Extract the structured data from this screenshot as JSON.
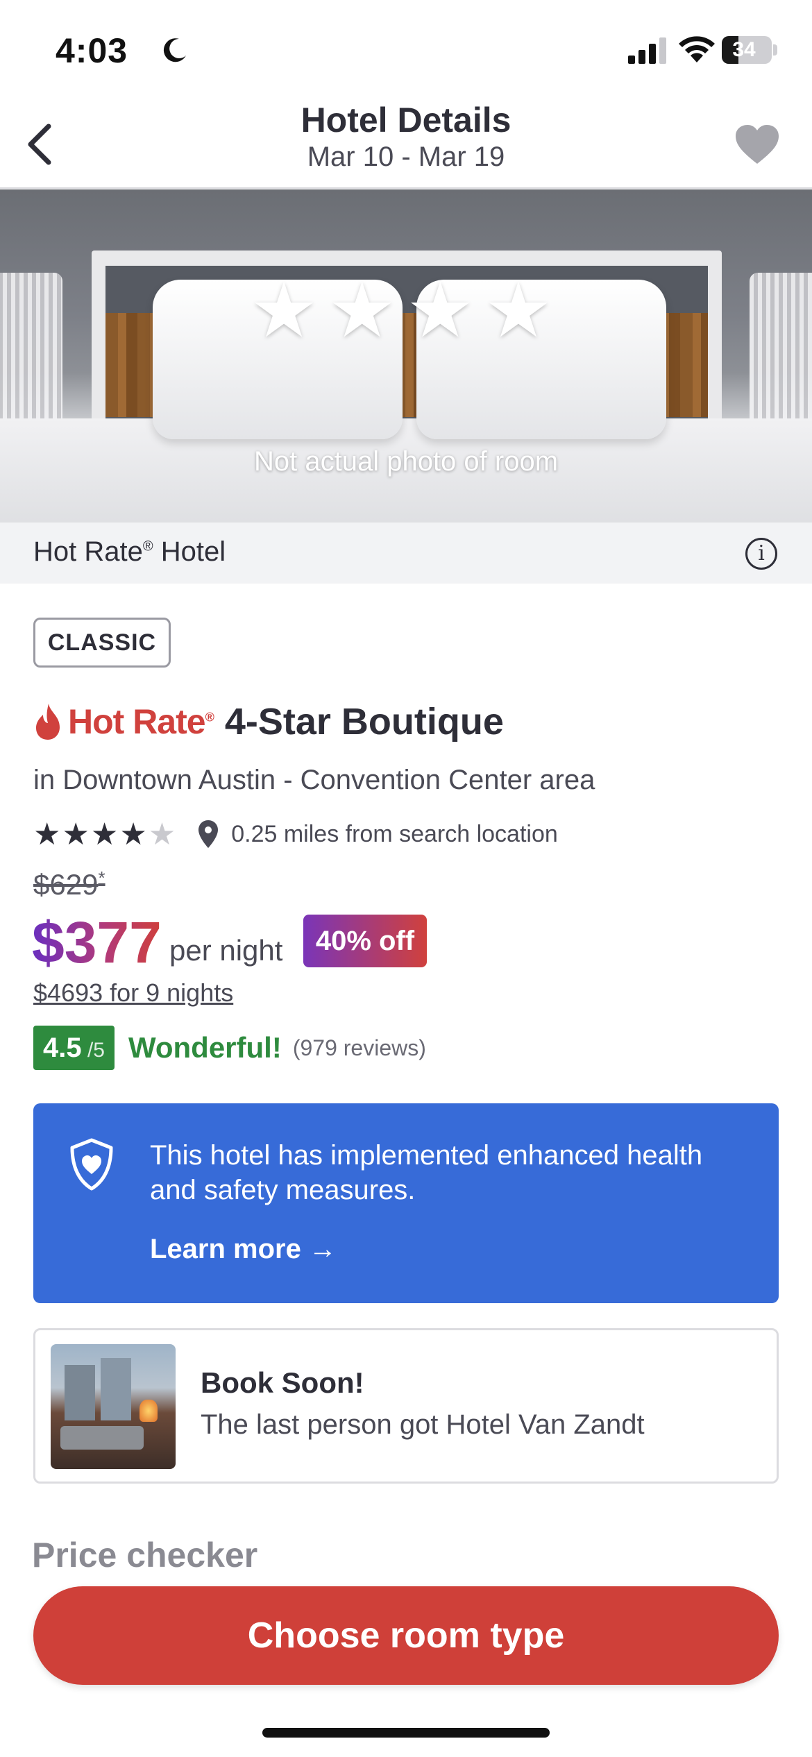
{
  "status_bar": {
    "time": "4:03",
    "battery_level": "34",
    "icons": [
      "moon-icon",
      "signal-icon",
      "wifi-icon",
      "battery-icon"
    ]
  },
  "header": {
    "title": "Hotel Details",
    "dates": "Mar 10 - Mar 19",
    "icons": [
      "back-chevron-icon",
      "heart-icon"
    ]
  },
  "hero": {
    "star_count": 4,
    "stars": "★★★★",
    "caption": "Not actual photo of room"
  },
  "hot_rate_bar": {
    "label": "Hot Rate",
    "registered": "®",
    "suffix": " Hotel",
    "icon": "info-icon"
  },
  "hotel": {
    "class_badge": "CLASSIC",
    "brand": "Hot Rate",
    "brand_mark": "®",
    "name": "4-Star Boutique",
    "location": "in Downtown Austin - Convention Center area",
    "star_rating": 4,
    "stars_filled": "★★★★",
    "stars_empty": "★",
    "distance": "0.25 miles from search location"
  },
  "pricing": {
    "original_price": "$629",
    "original_marker": "*",
    "price": "$377",
    "per_night_label": "per night",
    "discount_label": "40% off",
    "total": "$4693 for 9 nights"
  },
  "reviews": {
    "score": "4.5",
    "score_max": " /5",
    "label": "Wonderful!",
    "count": "(979 reviews)"
  },
  "health_card": {
    "text": "This hotel has implemented enhanced health and safety measures.",
    "link": "Learn more →",
    "icon": "shield-heart-icon"
  },
  "book_soon": {
    "title": "Book Soon!",
    "text": "The last person got Hotel Van Zandt"
  },
  "price_checker": {
    "heading": "Price checker"
  },
  "cta": {
    "label": "Choose room type"
  },
  "colors": {
    "brand_red": "#cf4039",
    "health_blue": "#376bd8",
    "review_green": "#2e8b3e",
    "price_gradient_start": "#6a2fbf",
    "price_gradient_end": "#cf3f3b"
  }
}
